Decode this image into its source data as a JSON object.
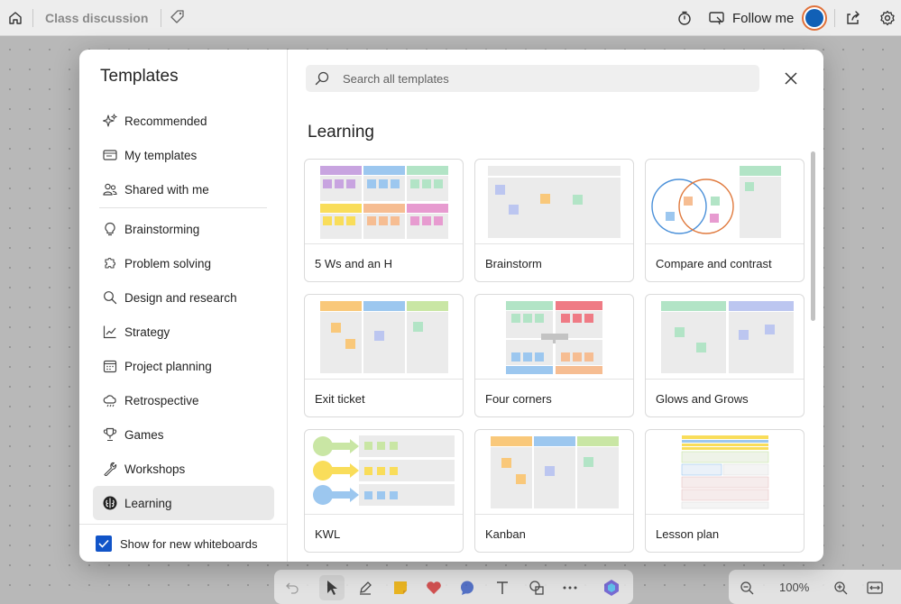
{
  "topbar": {
    "title": "Class discussion",
    "follow_label": "Follow me"
  },
  "modal": {
    "title": "Templates",
    "search_placeholder": "Search all templates",
    "section_title": "Learning",
    "nav": [
      {
        "label": "Recommended",
        "icon": "sparkle-icon"
      },
      {
        "label": "My templates",
        "icon": "my-templates-icon"
      },
      {
        "label": "Shared with me",
        "icon": "people-icon"
      },
      {
        "label": "Brainstorming",
        "icon": "lightbulb-icon"
      },
      {
        "label": "Problem solving",
        "icon": "puzzle-icon"
      },
      {
        "label": "Design and research",
        "icon": "search-icon"
      },
      {
        "label": "Strategy",
        "icon": "chart-line-icon"
      },
      {
        "label": "Project planning",
        "icon": "calendar-icon"
      },
      {
        "label": "Retrospective",
        "icon": "cloud-icon"
      },
      {
        "label": "Games",
        "icon": "trophy-icon"
      },
      {
        "label": "Workshops",
        "icon": "wrench-icon"
      },
      {
        "label": "Learning",
        "icon": "brain-icon",
        "active": true
      }
    ],
    "show_for_new_label": "Show for new whiteboards",
    "show_for_new_checked": true,
    "templates": [
      {
        "name": "5 Ws and an H"
      },
      {
        "name": "Brainstorm"
      },
      {
        "name": "Compare and contrast"
      },
      {
        "name": "Exit ticket"
      },
      {
        "name": "Four corners"
      },
      {
        "name": "Glows and Grows"
      },
      {
        "name": "KWL"
      },
      {
        "name": "Kanban"
      },
      {
        "name": "Lesson plan"
      }
    ]
  },
  "toolbar": {
    "zoom_level": "100%"
  },
  "colors": {
    "accent": "#1154c8",
    "avatar_fill": "#1160b6",
    "avatar_ring": "#e0713a",
    "purple": "#c8a4e0",
    "blue": "#9cc7ef",
    "green": "#b2e4c6",
    "yellow": "#f9dd5a",
    "orange": "#f6bd92",
    "pink": "#e79bd0",
    "red": "#ef7b85",
    "gray": "#ebebeb"
  }
}
